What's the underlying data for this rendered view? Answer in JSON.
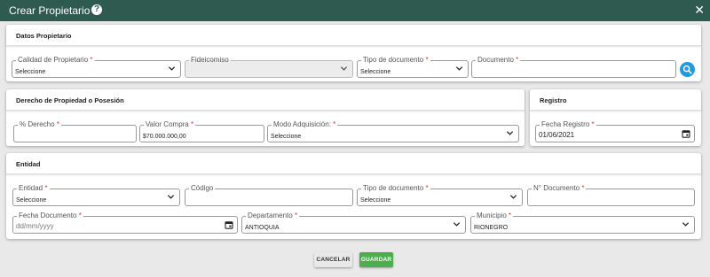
{
  "dialog": {
    "title": "Crear Propietario",
    "help_icon": "question-circle-icon",
    "close_icon": "close-icon"
  },
  "datos": {
    "title": "Datos Propietario",
    "calidad": {
      "label": "Calidad de Propietario",
      "value": "Seleccione"
    },
    "fideicomiso": {
      "label": "Fideicomiso",
      "value": ""
    },
    "tipo_documento": {
      "label": "Tipo de documento",
      "value": "Seleccione"
    },
    "documento": {
      "label": "Documento",
      "value": ""
    },
    "search_icon": "search-icon"
  },
  "derecho": {
    "title": "Derecho de Propiedad o Posesión",
    "porcentaje": {
      "label": "% Derecho",
      "value": ""
    },
    "valor_compra": {
      "label": "Valor Compra",
      "value": "$70.000.000,00"
    },
    "modo": {
      "label": "Modo Adquisición:",
      "value": "Seleccione"
    }
  },
  "registro": {
    "title": "Registro",
    "fecha": {
      "label": "Fecha Registro",
      "value": "01/06/2021"
    }
  },
  "entidad": {
    "title": "Entidad",
    "entidad": {
      "label": "Entidad",
      "value": "Seleccione"
    },
    "codigo": {
      "label": "Código",
      "value": ""
    },
    "tipo_documento": {
      "label": "Tipo de documento",
      "value": "Seleccione"
    },
    "numero_documento": {
      "label": "N° Documento",
      "value": ""
    },
    "fecha_documento": {
      "label": "Fecha Documento",
      "placeholder": "dd/mm/yyyy"
    },
    "departamento": {
      "label": "Departamento",
      "value": "ANTIOQUIA"
    },
    "municipio": {
      "label": "Municipio",
      "value": "RIONEGRO"
    }
  },
  "buttons": {
    "cancel": "CANCELAR",
    "save": "GUARDAR"
  },
  "colors": {
    "header": "#2f5a4f",
    "accent": "#1e9be0",
    "save": "#4cae4c",
    "required": "#d9342b"
  }
}
